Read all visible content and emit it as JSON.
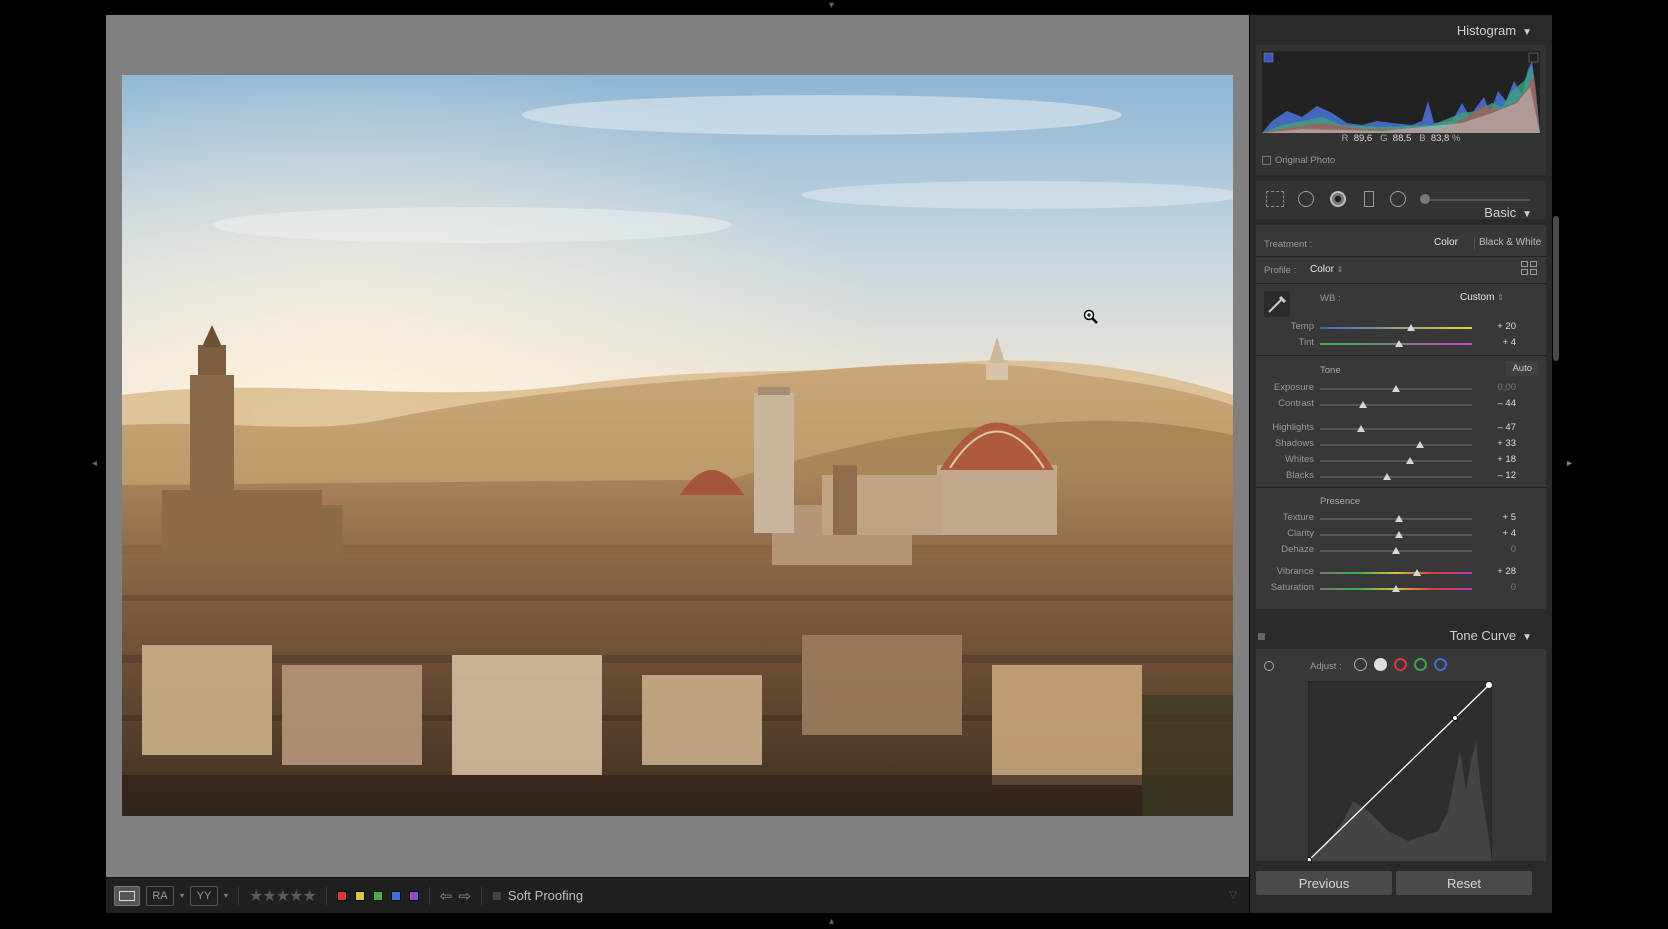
{
  "panels": {
    "histogram": {
      "title": "Histogram",
      "r_label": "R",
      "r_value": "89,6",
      "g_label": "G",
      "g_value": "88,5",
      "b_label": "B",
      "b_value": "83,8",
      "unit": "%",
      "original_photo_label": "Original Photo"
    },
    "basic": {
      "title": "Basic",
      "treatment_label": "Treatment :",
      "treatment_color": "Color",
      "treatment_bw": "Black & White",
      "profile_label": "Profile :",
      "profile_value": "Color",
      "wb_label": "WB :",
      "wb_value": "Custom",
      "tone_label": "Tone",
      "auto_label": "Auto",
      "presence_label": "Presence",
      "sliders": {
        "temp": {
          "label": "Temp",
          "value": "+ 20",
          "level": 0.6
        },
        "tint": {
          "label": "Tint",
          "value": "+ 4",
          "level": 0.52
        },
        "exposure": {
          "label": "Exposure",
          "value": "0,00",
          "level": 0.5
        },
        "contrast": {
          "label": "Contrast",
          "value": "– 44",
          "level": 0.28
        },
        "highlights": {
          "label": "Highlights",
          "value": "– 47",
          "level": 0.27
        },
        "shadows": {
          "label": "Shadows",
          "value": "+ 33",
          "level": 0.66
        },
        "whites": {
          "label": "Whites",
          "value": "+ 18",
          "level": 0.59
        },
        "blacks": {
          "label": "Blacks",
          "value": "– 12",
          "level": 0.44
        },
        "texture": {
          "label": "Texture",
          "value": "+ 5",
          "level": 0.52
        },
        "clarity": {
          "label": "Clarity",
          "value": "+ 4",
          "level": 0.52
        },
        "dehaze": {
          "label": "Dehaze",
          "value": "0",
          "level": 0.5
        },
        "vibrance": {
          "label": "Vibrance",
          "value": "+ 28",
          "level": 0.64
        },
        "saturation": {
          "label": "Saturation",
          "value": "0",
          "level": 0.5
        }
      }
    },
    "tone_curve": {
      "title": "Tone Curve",
      "adjust_label": "Adjust :"
    }
  },
  "buttons": {
    "previous": "Previous",
    "reset": "Reset"
  },
  "toolbar": {
    "soft_proofing": "Soft Proofing",
    "ra_label": "RA",
    "yy_label": "YY",
    "stars": "★★★★★",
    "color_labels": [
      "#d23c3c",
      "#d4c83a",
      "#4cad46",
      "#3f6fd1",
      "#8a4fc4"
    ]
  },
  "icons": {
    "zoom": "zoom-in-icon",
    "eyedropper": "eyedropper-icon",
    "grid": "grid-icon"
  }
}
